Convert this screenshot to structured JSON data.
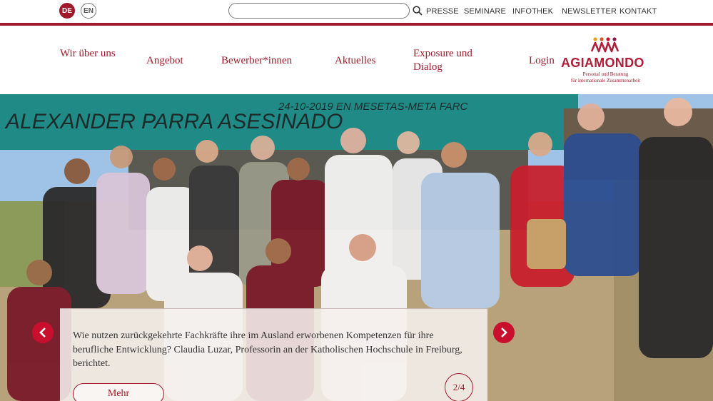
{
  "languages": {
    "de": "DE",
    "en": "EN",
    "active": "DE"
  },
  "search": {
    "value": "",
    "placeholder": ""
  },
  "top_links": [
    "PRESSE",
    "SEMINARE",
    "INFOTHEK",
    "NEWSLETTER",
    "KONTAKT"
  ],
  "nav": {
    "items": [
      "Wir über uns",
      "Angebot",
      "Bewerber*innen",
      "Aktuelles",
      "Exposure und Dialog"
    ],
    "login": "Login"
  },
  "logo": {
    "name": "AGIAMONDO",
    "tagline_line1": "Personal und Beratung",
    "tagline_line2": "für internationale Zusammenarbeit"
  },
  "hero": {
    "banner_text_1": "ALEXANDER PARRA ASESINADO",
    "banner_text_2": "24-10-2019 EN MESETAS-META FARC",
    "caption": "Wie nutzen zurückgekehrte Fachkräfte ihre im Ausland erworbenen Kompetenzen für ihre berufliche Entwicklung? Claudia Luzar, Professorin an der Katholischen Hochschule in Freiburg, berichtet.",
    "more_label": "Mehr",
    "pager": "2/4"
  },
  "colors": {
    "accent": "#a01a2c",
    "arrow": "#c8102e",
    "banner": "#1f8a86"
  },
  "icons": {
    "search": "search-icon",
    "prev": "chevron-left-icon",
    "next": "chevron-right-icon"
  }
}
